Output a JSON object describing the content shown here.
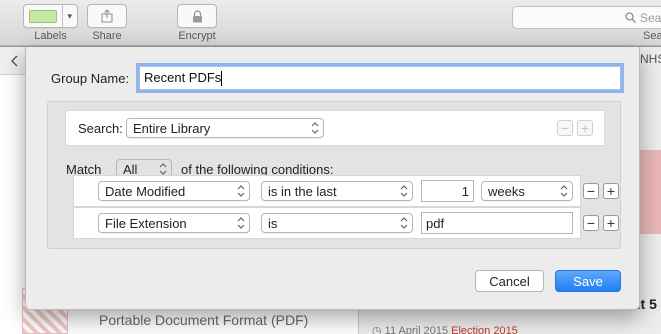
{
  "toolbar": {
    "labels_label": "Labels",
    "share_label": "Share",
    "encrypt_label": "Encrypt",
    "search_placeholder": "Sea",
    "search_label": "Sea",
    "labels_color": "#c7e7a4"
  },
  "background": {
    "pdf_type": "Portable Document Format (PDF)",
    "right_corner": "NHS",
    "right_bold": "ut 5",
    "right_bottom_date": "11 April 2015",
    "right_bottom_tag": "Election 2015"
  },
  "sheet": {
    "group_name_label": "Group Name:",
    "group_name_value": "Recent PDFs",
    "search_label": "Search:",
    "search_scope": "Entire Library",
    "match_label": "Match",
    "match_value": "All",
    "following_label": "of the following conditions:",
    "conditions": [
      {
        "field": "Date Modified",
        "operator": "is in the last",
        "value": "1",
        "unit": "weeks"
      },
      {
        "field": "File Extension",
        "operator": "is",
        "value": "pdf"
      }
    ],
    "cancel_label": "Cancel",
    "save_label": "Save",
    "accent": "#1f7ff5"
  }
}
